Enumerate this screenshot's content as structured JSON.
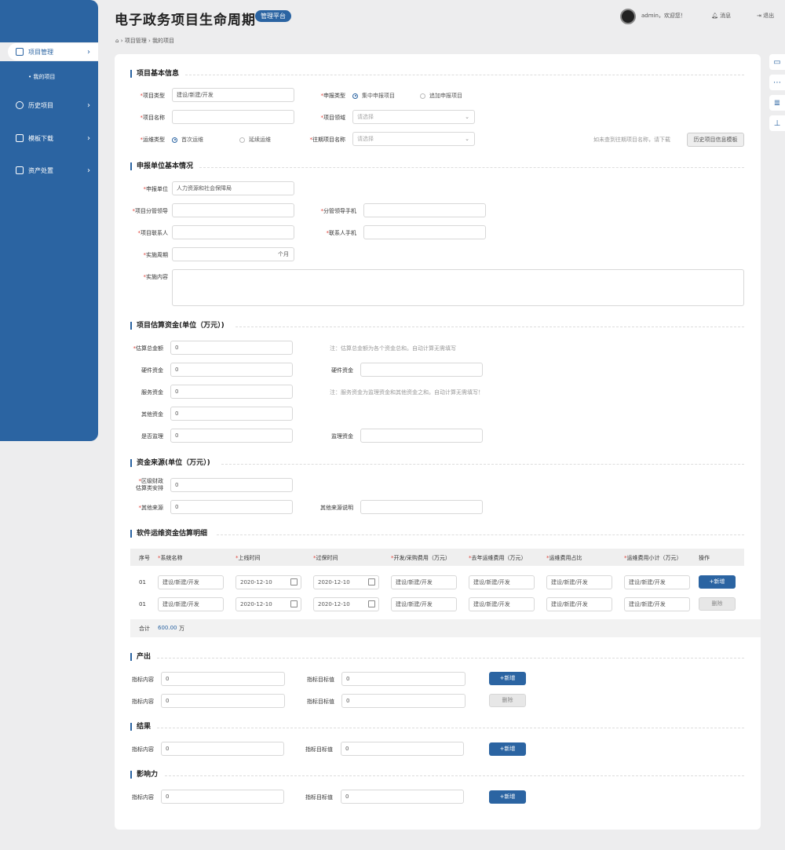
{
  "header": {
    "title": "电子政务项目生命周期",
    "badge": "管理平台",
    "user": "admin，欢迎您！",
    "messages": "消息",
    "logout": "退出"
  },
  "breadcrumb": {
    "items": [
      "项目管理",
      "我的项目"
    ]
  },
  "sidebar": {
    "items": [
      {
        "label": "项目管理"
      },
      {
        "label": "历史项目"
      },
      {
        "label": "模板下载"
      },
      {
        "label": "资产处置"
      }
    ],
    "sub_item": "• 我的项目"
  },
  "sections": {
    "basic": "项目基本信息",
    "unit": "申报单位基本情况",
    "funds": "项目估算资金(单位（万元）)",
    "source": "资金来源(单位（万元）)",
    "software": "软件运维资金估算明细",
    "output": "产出",
    "result": "结果",
    "impact": "影响力"
  },
  "basic": {
    "project_type_label": "项目类型",
    "project_type_value": "建设/新建/开发",
    "declare_type_label": "申报类型",
    "declare_type_opt1": "集中申报项目",
    "declare_type_opt2": "追加申报项目",
    "project_name_label": "项目名称",
    "project_field_label": "项目领域",
    "project_field_placeholder": "请选择",
    "ops_type_label": "运维类型",
    "ops_type_opt1": "首次运维",
    "ops_type_opt2": "延续运维",
    "prev_project_label": "往期项目名称",
    "prev_project_placeholder": "请选择",
    "prev_note": "如未查到往期项目名称，请下载",
    "template_button": "历史项目信息模板"
  },
  "unit": {
    "declare_unit_label": "申报单位",
    "declare_unit_value": "人力资源和社会保障局",
    "leader_label": "项目分管领导",
    "leader_phone_label": "分管领导手机",
    "contact_label": "项目联系人",
    "contact_phone_label": "联系人手机",
    "period_label": "实施周期",
    "period_suffix": "个月",
    "content_label": "实施内容"
  },
  "funds": {
    "total_label": "估算总金额",
    "total_value": "0",
    "total_note": "注：估算总金额为各个资金总和。自动计算无需填写",
    "hardware_label": "硬件资金",
    "hardware_value": "0",
    "hardware_label2": "硬件资金",
    "service_label": "服务资金",
    "service_value": "0",
    "service_note": "注：服务资金为监理资金和其他资金之和。自动计算无需填写！",
    "other_label": "其他资金",
    "other_value": "0",
    "supervise_label": "是否监理",
    "supervise_value": "0",
    "supervise_fund_label": "监理资金"
  },
  "source": {
    "district_label_1": "区级财政",
    "district_label_2": "估算类安排",
    "district_value": "0",
    "other_label": "其他来源",
    "other_value": "0",
    "other_desc_label": "其他来源说明"
  },
  "table": {
    "headers": [
      "序号",
      "系统名称",
      "上线时间",
      "过保时间",
      "开发/采购费用（万元）",
      "去年运维费用（万元）",
      "运维费用占比",
      "运维费用小计（万元）",
      "操作"
    ],
    "rows": [
      {
        "no": "01",
        "name": "建设/新建/开发",
        "online": "2020-12-10",
        "warranty": "2020-12-10",
        "dev": "建设/新建/开发",
        "last": "建设/新建/开发",
        "ratio": "建设/新建/开发",
        "subtotal": "建设/新建/开发",
        "action": "+新增"
      },
      {
        "no": "01",
        "name": "建设/新建/开发",
        "online": "2020-12-10",
        "warranty": "2020-12-10",
        "dev": "建设/新建/开发",
        "last": "建设/新建/开发",
        "ratio": "建设/新建/开发",
        "subtotal": "建设/新建/开发",
        "action": "删除"
      }
    ],
    "total_label": "合计",
    "total_value": "600.00",
    "total_unit": "万"
  },
  "indicator": {
    "content_label": "指标内容",
    "target_label": "指标目标值",
    "value": "0",
    "add": "+新增",
    "delete": "删除"
  },
  "colors": {
    "primary": "#2b64a2",
    "required": "#e0443b"
  }
}
